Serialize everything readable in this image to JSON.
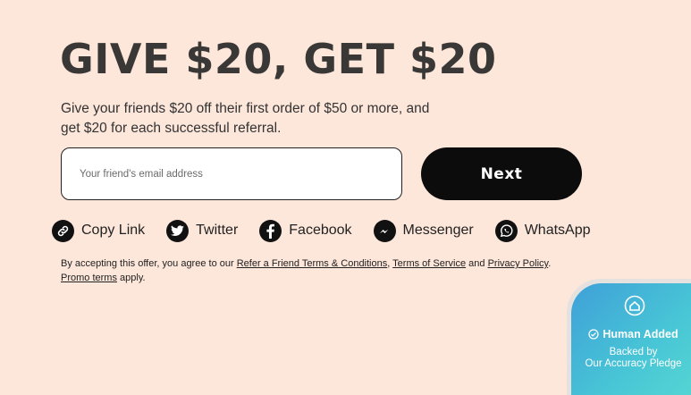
{
  "headline": "GIVE $20, GET $20",
  "subtext": "Give your friends $20 off their first order of $50 or more, and get $20 for each successful referral.",
  "email": {
    "placeholder": "Your friend's email address",
    "value": ""
  },
  "next_label": "Next",
  "share": [
    {
      "label": "Copy Link",
      "icon": "link-icon"
    },
    {
      "label": "Twitter",
      "icon": "twitter-icon"
    },
    {
      "label": "Facebook",
      "icon": "facebook-icon"
    },
    {
      "label": "Messenger",
      "icon": "messenger-icon"
    },
    {
      "label": "WhatsApp",
      "icon": "whatsapp-icon"
    }
  ],
  "terms": {
    "prefix": "By accepting this offer, you agree to our ",
    "link1": "Refer a Friend Terms & Conditions",
    "sep1": ", ",
    "link2": "Terms of Service",
    "sep2": " and ",
    "link3": "Privacy Policy",
    "sep3": ".",
    "link4": "Promo terms",
    "suffix": " apply."
  },
  "badge": {
    "title": "Human Added",
    "subtitle_line1": "Backed by",
    "subtitle_line2": "Our Accuracy Pledge"
  },
  "colors": {
    "background": "#fde6da",
    "button": "#0c0c0c",
    "badge_gradient_start": "#3fa0d8",
    "badge_gradient_end": "#56d6d2"
  }
}
